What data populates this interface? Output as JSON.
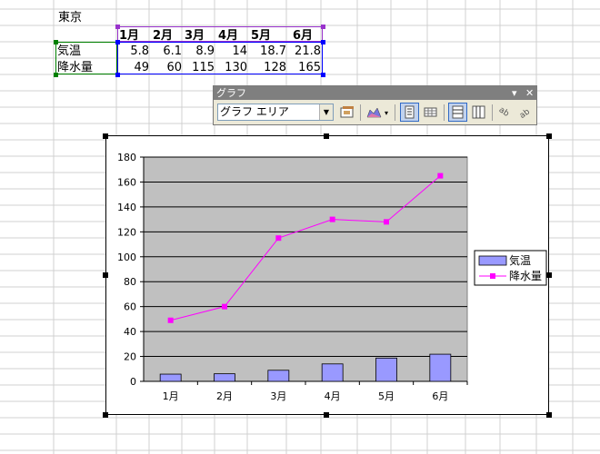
{
  "sheet": {
    "title_cell": "東京",
    "columns": [
      "1月",
      "2月",
      "3月",
      "4月",
      "5月",
      "6月"
    ],
    "rows": [
      {
        "label": "気温",
        "values": [
          "5.8",
          "6.1",
          "8.9",
          "14",
          "18.7",
          "21.8"
        ]
      },
      {
        "label": "降水量",
        "values": [
          "49",
          "60",
          "115",
          "130",
          "128",
          "165"
        ]
      }
    ]
  },
  "toolbar": {
    "title": "グラフ",
    "combo_value": "グラフ エリア",
    "buttons": [
      "format-chart-area-icon",
      "chart-type-icon",
      "legend-icon",
      "data-table-icon",
      "by-row-icon",
      "by-column-icon",
      "angle-text-downward-icon",
      "angle-text-upward-icon"
    ]
  },
  "colors": {
    "bar_fill": "#9999ff",
    "line": "#ff00ff",
    "plot_bg": "#c0c0c0",
    "gridline": "#cfcfcf",
    "title_bar": "#7f7f7f",
    "selection_purple": "#9933cc",
    "selection_blue": "#0000ff",
    "selection_green": "#008000"
  },
  "chart_data": {
    "type": "bar",
    "categories": [
      "1月",
      "2月",
      "3月",
      "4月",
      "5月",
      "6月"
    ],
    "series": [
      {
        "name": "気温",
        "type": "bar",
        "values": [
          5.8,
          6.1,
          8.9,
          14,
          18.7,
          21.8
        ]
      },
      {
        "name": "降水量",
        "type": "line",
        "values": [
          49,
          60,
          115,
          130,
          128,
          165
        ]
      }
    ],
    "ylim": [
      0,
      180
    ],
    "yticks": [
      0,
      20,
      40,
      60,
      80,
      100,
      120,
      140,
      160,
      180
    ],
    "grid": true,
    "legend_position": "right"
  }
}
